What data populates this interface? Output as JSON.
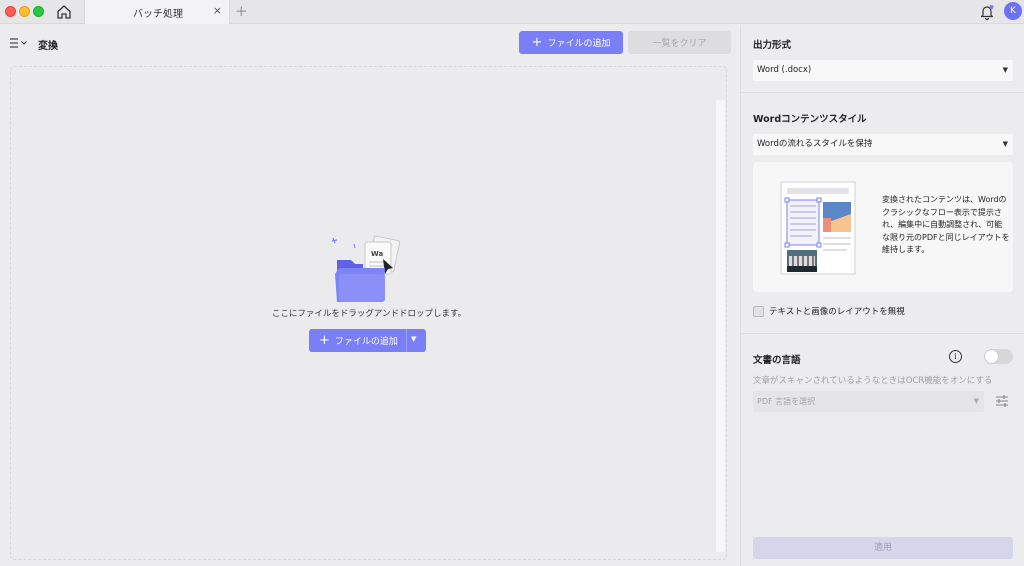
{
  "titlebar": {
    "tab_label": "バッチ処理",
    "tab_close": "×",
    "tab_add": "+",
    "avatar_initial": "K"
  },
  "toolbar": {
    "title": "変換",
    "add_files_label": "ファイルの追加",
    "clear_list_label": "一覧をクリア"
  },
  "dropzone": {
    "instruction": "ここにファイルをドラッグアンドドロップします。",
    "add_files_label": "ファイルの追加"
  },
  "panel": {
    "output_format_label": "出力形式",
    "output_format_value": "Word (.docx)",
    "word_style_label": "Wordコンテンツスタイル",
    "word_style_value": "Wordの流れるスタイルを保持",
    "style_description": "変換されたコンテンツは、Wordのクラシックなフロー表示で提示され、編集中に自動調整され、可能な限り元のPDFと同じレイアウトを維持します。",
    "ignore_layout_label": "テキストと画像のレイアウトを無視",
    "ignore_layout_checked": false,
    "doc_language_label": "文書の言語",
    "ocr_toggle_on": false,
    "ocr_hint": "文章がスキャンされているようなときはOCR機能をオンにする",
    "language_placeholder": "PDF 言語を選択",
    "apply_label": "適用"
  },
  "icons": {
    "home": "home-icon",
    "bell": "bell-icon",
    "menu": "menu-icon",
    "info": "info-icon",
    "settings": "sliders-icon"
  },
  "colors": {
    "accent": "#7b7ff7",
    "avatar": "#6b72f5"
  }
}
